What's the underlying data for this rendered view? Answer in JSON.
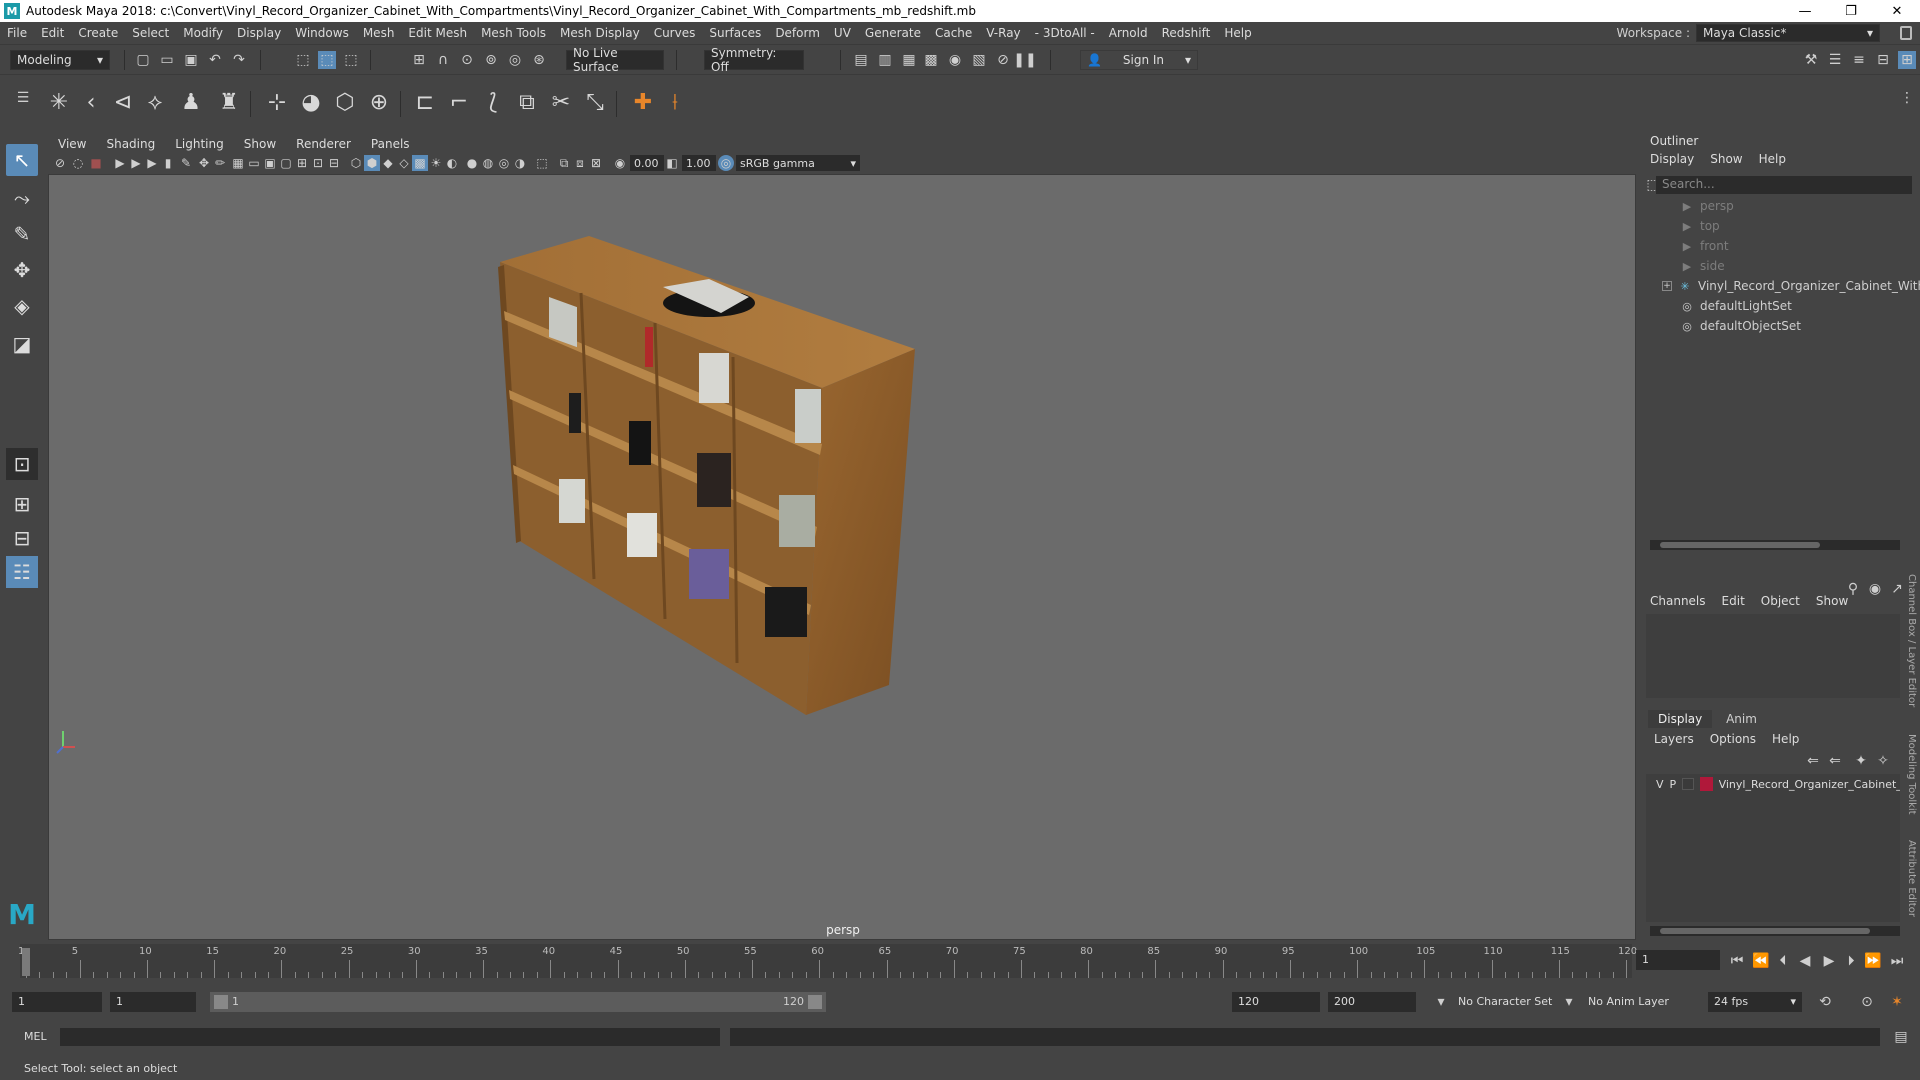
{
  "window": {
    "app_icon": "M",
    "title": "Autodesk Maya 2018: c:\\Convert\\Vinyl_Record_Organizer_Cabinet_With_Compartments\\Vinyl_Record_Organizer_Cabinet_With_Compartments_mb_redshift.mb",
    "minimize": "—",
    "maximize": "❐",
    "close": "✕"
  },
  "menubar": {
    "items": [
      "File",
      "Edit",
      "Create",
      "Select",
      "Modify",
      "Display",
      "Windows",
      "Mesh",
      "Edit Mesh",
      "Mesh Tools",
      "Mesh Display",
      "Curves",
      "Surfaces",
      "Deform",
      "UV",
      "Generate",
      "Cache",
      "V-Ray",
      "- 3DtoAll -",
      "Arnold",
      "Redshift",
      "Help"
    ],
    "workspace_label": "Workspace :",
    "workspace_value": "Maya Classic*"
  },
  "statusline": {
    "mode": "Modeling",
    "live_surface": "No Live Surface",
    "symmetry": "Symmetry: Off",
    "sign_in": "Sign In"
  },
  "viewport": {
    "menu": [
      "View",
      "Shading",
      "Lighting",
      "Show",
      "Renderer",
      "Panels"
    ],
    "exposure": "0.00",
    "gamma": "1.00",
    "color_space": "sRGB gamma",
    "camera": "persp"
  },
  "outliner": {
    "title": "Outliner",
    "menu": [
      "Display",
      "Show",
      "Help"
    ],
    "search_placeholder": "Search...",
    "items": [
      {
        "label": "persp",
        "dim": true
      },
      {
        "label": "top",
        "dim": true
      },
      {
        "label": "front",
        "dim": true
      },
      {
        "label": "side",
        "dim": true
      },
      {
        "label": "Vinyl_Record_Organizer_Cabinet_With_C",
        "dim": false
      },
      {
        "label": "defaultLightSet",
        "dim": false
      },
      {
        "label": "defaultObjectSet",
        "dim": false
      }
    ]
  },
  "channelbox": {
    "menu": [
      "Channels",
      "Edit",
      "Object",
      "Show"
    ]
  },
  "layereditor": {
    "tabs": [
      "Display",
      "Anim"
    ],
    "menu": [
      "Layers",
      "Options",
      "Help"
    ],
    "layer": {
      "v": "V",
      "p": "P",
      "name": "Vinyl_Record_Organizer_Cabinet_W",
      "color": "#b0183a"
    }
  },
  "side_tabs": [
    "Channel Box / Layer Editor",
    "Modeling Toolkit",
    "Attribute Editor"
  ],
  "timeslider": {
    "ticks": [
      "1",
      "5",
      "10",
      "15",
      "20",
      "25",
      "30",
      "35",
      "40",
      "45",
      "50",
      "55",
      "60",
      "65",
      "70",
      "75",
      "80",
      "85",
      "90",
      "95",
      "100",
      "105",
      "110",
      "115",
      "120"
    ],
    "current_frame": "1"
  },
  "rangeslider": {
    "start": "1",
    "current": "1",
    "range_start": "1",
    "range_end": "120",
    "end": "120",
    "max": "200",
    "character_set": "No Character Set",
    "anim_layer": "No Anim Layer",
    "fps": "24 fps"
  },
  "cmdline": {
    "label": "MEL"
  },
  "helpline": {
    "text": "Select Tool: select an object"
  }
}
